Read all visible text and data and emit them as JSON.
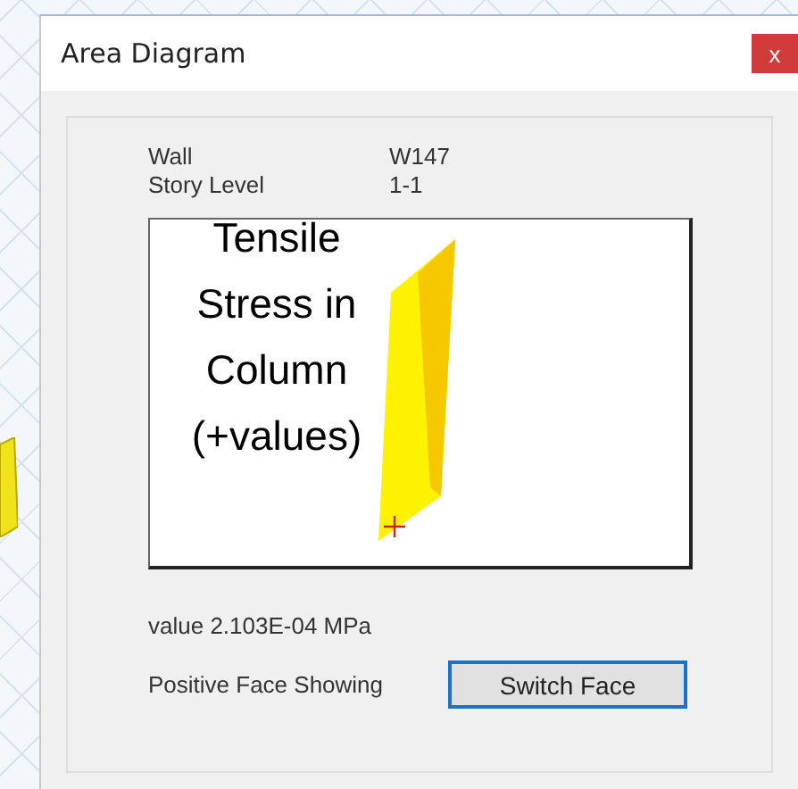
{
  "window": {
    "title": "Area Diagram",
    "close": "x"
  },
  "fields": [
    {
      "label": "Wall",
      "value": "W147"
    },
    {
      "label": "Story Level",
      "value": "1-1"
    }
  ],
  "annotation": "Tensile Stress in Column (+values)",
  "value_text": "value 2.103E-04 MPa",
  "face_status": "Positive Face Showing",
  "switch_button": {
    "label": "Switch Face",
    "focused": true
  }
}
